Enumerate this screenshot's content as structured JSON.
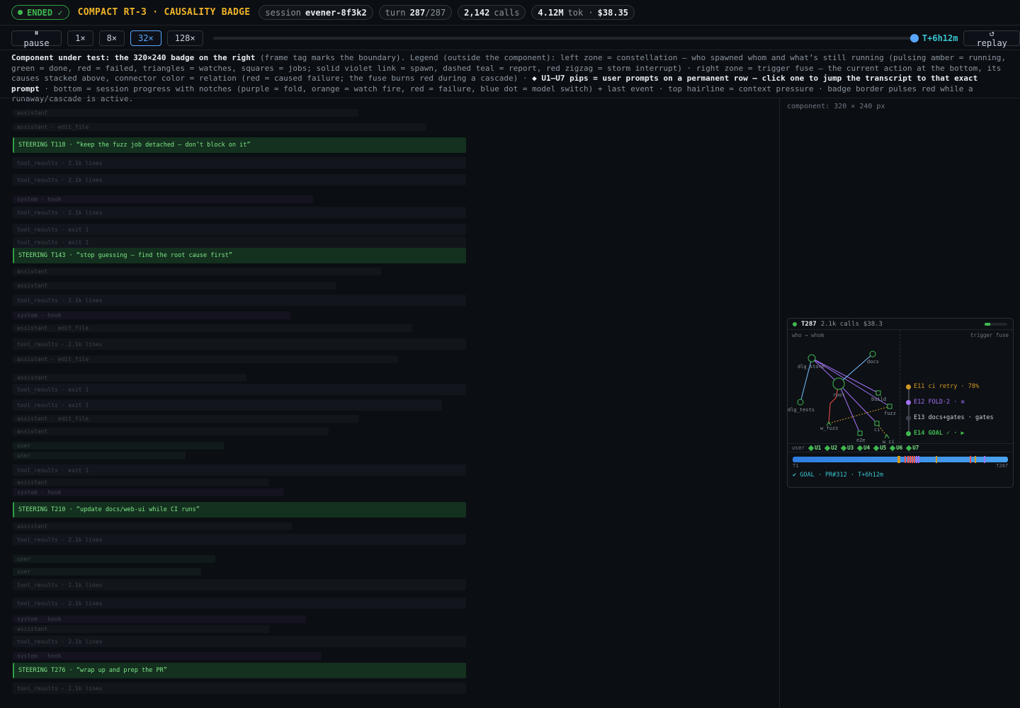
{
  "topbar": {
    "status": "ENDED ✓",
    "title": "COMPACT RT-3 · CAUSALITY BADGE",
    "session_label": "session",
    "session_value": "evener-8f3k2",
    "turn_label": "turn",
    "turn_value": "287",
    "turn_total": "/287",
    "calls_value": "2,142",
    "calls_label": "calls",
    "tok_value": "4.12M",
    "tok_label": "tok ·",
    "cost_value": "$38.35"
  },
  "controls": {
    "pause": "⏸ pause",
    "speeds": [
      "1×",
      "8×",
      "32×",
      "128×"
    ],
    "active_speed": "32×",
    "progress": 1.0,
    "time": "T+6h12m",
    "replay": "↺ replay"
  },
  "legend": {
    "lead": "Component under test: the 320×240 badge on the right",
    "body1": " (frame tag marks the boundary). Legend (outside the component): left zone = constellation — who spawned whom and what’s still running (pulsing amber = running, green = done, red = failed, triangles = watches, squares = jobs; solid violet link = spawn, dashed teal = report, red zigzag = storm interrupt) · right zone = trigger fuse — the current action at the bottom, its causes stacked above, connector color = relation (red = caused failure; the fuse burns red during a cascade) · ",
    "strong2": "◆ U1–U7 pips = user prompts on a permanent row — click one to jump the transcript to that exact prompt",
    "body2": " · bottom = session progress with notches (purple = fold, orange = watch fire, red = failure, blue dot = model switch) + last event · top hairline = context pressure · badge border pulses red while a runaway/cascade is active."
  },
  "transcript": {
    "rows": [
      {
        "kind": "as",
        "text": "assistant"
      },
      {
        "kind": "as",
        "text": "assistant · edit_file"
      },
      {
        "kind": "steer",
        "text": "STEERING T118 · “keep the fuzz job detached — don’t block on it”"
      },
      {
        "kind": "tr",
        "text": "tool_results · 2.1k lines"
      },
      {
        "kind": "tr",
        "text": "tool_results · 2.1k lines"
      },
      {
        "kind": "sy",
        "text": "system · hook"
      },
      {
        "kind": "tr",
        "text": "tool_results · 2.1k lines"
      },
      {
        "kind": "tr",
        "text": "tool_results · exit 1"
      },
      {
        "kind": "tr",
        "text": "tool_results · exit 1"
      },
      {
        "kind": "steer",
        "text": "STEERING T143 · “stop guessing — find the root cause first”"
      },
      {
        "kind": "as",
        "text": "assistant"
      },
      {
        "kind": "as",
        "text": "assistant"
      },
      {
        "kind": "tr",
        "text": "tool_results · 2.1k lines"
      },
      {
        "kind": "sy",
        "text": "system · hook"
      },
      {
        "kind": "as",
        "text": "assistant · edit_file"
      },
      {
        "kind": "tr",
        "text": "tool_results · 2.1k lines"
      },
      {
        "kind": "as",
        "text": "assistant · edit_file"
      },
      {
        "kind": "as",
        "text": "assistant"
      },
      {
        "kind": "tr",
        "text": "tool_results · exit 1"
      },
      {
        "kind": "tr",
        "text": "tool_results · exit 1"
      },
      {
        "kind": "as",
        "text": "assistant · edit_file"
      },
      {
        "kind": "as",
        "text": "assistant"
      },
      {
        "kind": "us",
        "text": "user"
      },
      {
        "kind": "us",
        "text": "user"
      },
      {
        "kind": "tr",
        "text": "tool_results · exit 1"
      },
      {
        "kind": "as",
        "text": "assistant"
      },
      {
        "kind": "sy",
        "text": "system · hook"
      },
      {
        "kind": "steer",
        "text": "STEERING T210 · “update docs/web-ui while CI runs”"
      },
      {
        "kind": "as",
        "text": "assistant"
      },
      {
        "kind": "tr",
        "text": "tool_results · 2.1k lines"
      },
      {
        "kind": "us",
        "text": "user"
      },
      {
        "kind": "us",
        "text": "user"
      },
      {
        "kind": "tr",
        "text": "tool_results · 2.1k lines"
      },
      {
        "kind": "tr",
        "text": "tool_results · 2.1k lines"
      },
      {
        "kind": "sy",
        "text": "system · hook"
      },
      {
        "kind": "as",
        "text": "assistant"
      },
      {
        "kind": "tr",
        "text": "tool_results · 2.1k lines"
      },
      {
        "kind": "sy",
        "text": "system · hook"
      },
      {
        "kind": "steer",
        "text": "STEERING T276 · “wrap up and prep the PR”"
      },
      {
        "kind": "tr",
        "text": "tool_results · 2.1k lines"
      }
    ]
  },
  "component_label": "component: 320 × 240 px",
  "badge": {
    "turn": "T287",
    "calls": "2.1k calls",
    "cost": "$38.3",
    "context_pressure": 0.25,
    "zone_left": "who → whom",
    "zone_right": "trigger fuse",
    "nodes": {
      "dlg_store": "dlg_store",
      "docs": "docs",
      "root": "root",
      "build": "build",
      "fuzz": "fuzz",
      "dlg_tests": "dlg_tests",
      "w_fuzz": "w_fuzz",
      "ci": "ci",
      "e2e": "e2e",
      "w_ci": "w_ci"
    },
    "fuse": [
      {
        "text": "E11 ci retry · 78%",
        "color": "#d29922"
      },
      {
        "text": "E12 FOLD·2 · ≡",
        "color": "#a371f7"
      },
      {
        "text": "E13 docs+gates · gates",
        "color": "#8b949e"
      },
      {
        "text": "E14 GOAL ✓ · ▶",
        "color": "#3fb950"
      }
    ],
    "user_label": "user",
    "pips": [
      "U1",
      "U2",
      "U3",
      "U4",
      "U5",
      "U6",
      "U7"
    ],
    "progress_start": "T1",
    "progress_end": "T287",
    "last_event": "✔ GOAL · PR#312 · T+6h12m",
    "colors": {
      "fold": "#a371f7",
      "watch": "#d29922",
      "failure": "#f85149",
      "switch": "#58a6ff"
    }
  }
}
